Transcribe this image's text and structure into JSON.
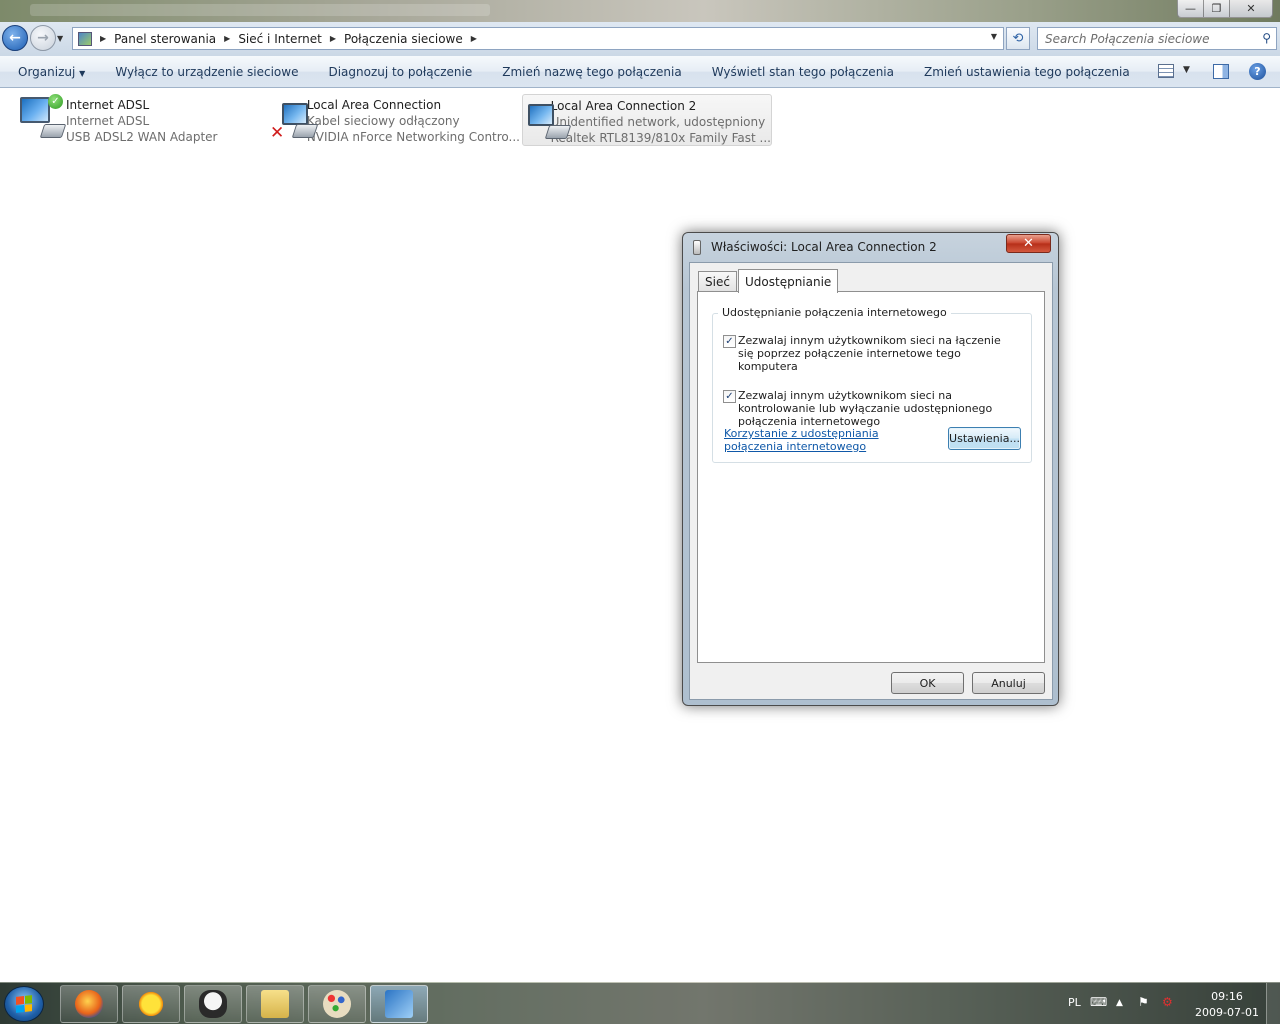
{
  "window": {
    "title_blurred": true,
    "controls": {
      "minimize": "—",
      "maximize": "❐",
      "close": "✕"
    }
  },
  "address": {
    "crumbs": [
      "Panel sterowania",
      "Sieć i Internet",
      "Połączenia sieciowe"
    ],
    "search_placeholder": "Search Połączenia sieciowe"
  },
  "commandbar": {
    "items": [
      "Organizuj",
      "Wyłącz to urządzenie sieciowe",
      "Diagnozuj to połączenie",
      "Zmień nazwę tego połączenia",
      "Wyświetl stan tego połączenia",
      "Zmień ustawienia tego połączenia"
    ]
  },
  "connections": [
    {
      "name": "Internet ADSL",
      "status": "Internet ADSL",
      "device": "USB ADSL2 WAN Adapter",
      "badge": "ok",
      "selected": false
    },
    {
      "name": "Local Area Connection",
      "status": "Kabel sieciowy odłączony",
      "device": "NVIDIA nForce Networking Contro...",
      "badge": "error",
      "selected": false
    },
    {
      "name": "Local Area Connection 2",
      "status": "Unidentified network, udostępniony",
      "device": "Realtek RTL8139/810x Family Fast ...",
      "badge": "none",
      "selected": true
    }
  ],
  "dialog": {
    "title": "Właściwości: Local Area Connection 2",
    "tabs": [
      "Sieć",
      "Udostępnianie"
    ],
    "active_tab": "Udostępnianie",
    "group_label": "Udostępnianie połączenia internetowego",
    "checkbox1": {
      "label": "Zezwalaj innym użytkownikom sieci na łączenie się poprzez połączenie internetowe tego komputera",
      "checked": true
    },
    "checkbox2": {
      "label": "Zezwalaj innym użytkownikom sieci na kontrolowanie lub wyłączanie udostępnionego połączenia internetowego",
      "checked": true
    },
    "link": "Korzystanie z udostępniania połączenia internetowego",
    "settings_button": "Ustawienia...",
    "ok_button": "OK",
    "cancel_button": "Anuluj"
  },
  "taskbar": {
    "language": "PL",
    "time": "09:16",
    "date": "2009-07-01"
  }
}
